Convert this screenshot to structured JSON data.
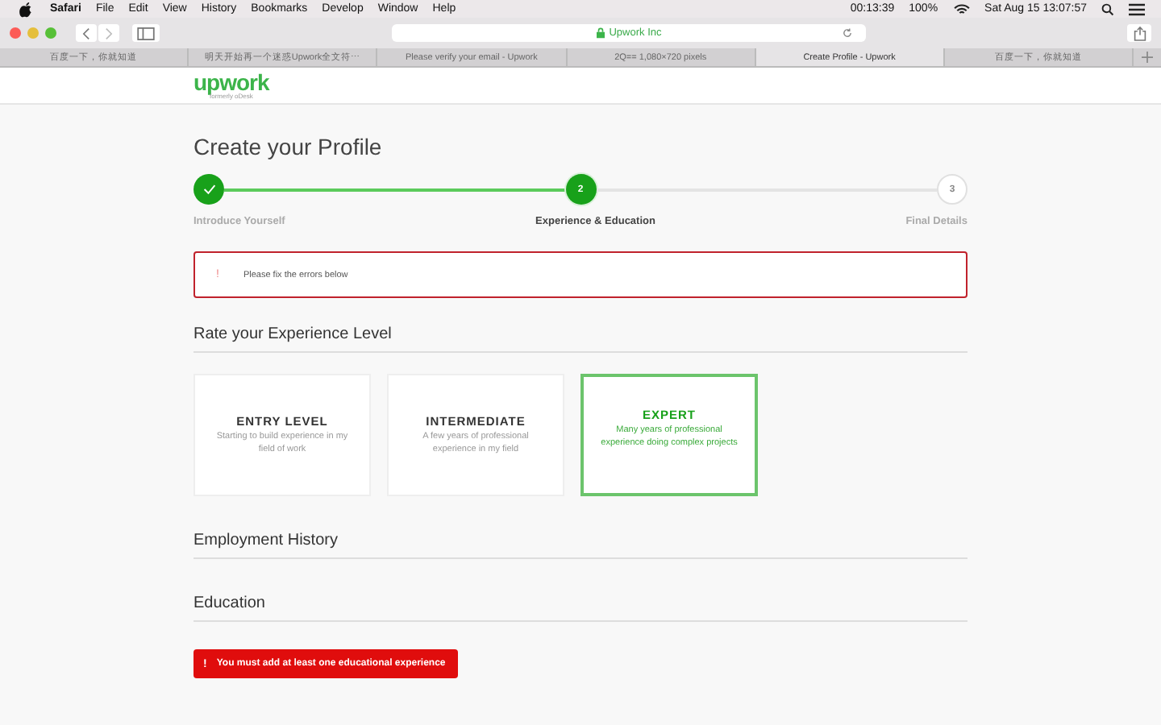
{
  "menu_bar": {
    "app": "Safari",
    "items": [
      "File",
      "Edit",
      "View",
      "History",
      "Bookmarks",
      "Develop",
      "Window",
      "Help"
    ],
    "clock_timer": "00:13:39",
    "battery": "100%",
    "date_time": "Sat Aug 15  13:07:57"
  },
  "toolbar": {
    "address": "Upwork Inc"
  },
  "tabs": [
    {
      "label": "百度一下，你就知道",
      "selected": false
    },
    {
      "label": "明天开始再一个迷惑Upwork全文符⋯",
      "selected": false
    },
    {
      "label": "Please verify your email - Upwork",
      "selected": false
    },
    {
      "label": "2Q== 1,080×720 pixels",
      "selected": false
    },
    {
      "label": "Create Profile - Upwork",
      "selected": true
    },
    {
      "label": "百度一下，你就知道",
      "selected": false
    }
  ],
  "header": {
    "logo": "upwork",
    "tagline": "formerly oDesk"
  },
  "title": "Create your Profile",
  "steps": [
    {
      "label": "Introduce Yourself",
      "completed": true,
      "selected": false
    },
    {
      "label": "Experience & Education",
      "number": "2",
      "completed": false,
      "selected": true
    },
    {
      "label": "Final Details",
      "number": "3",
      "completed": false,
      "selected": false
    }
  ],
  "alert": {
    "icon": "!",
    "message": "Please fix the errors below"
  },
  "experience": {
    "heading": "Rate your Experience Level",
    "levels": [
      {
        "title": "ENTRY LEVEL",
        "description": "Starting to build experience in my field of work",
        "selected": false
      },
      {
        "title": "INTERMEDIATE",
        "description": "A few years of professional experience in my field",
        "selected": false
      },
      {
        "title": "EXPERT",
        "description": "Many years of professional experience doing complex projects",
        "selected": true
      }
    ]
  },
  "sections": [
    "Employment History",
    "Education"
  ],
  "education_error": {
    "icon": "!",
    "message": "You must add at least one educational experience"
  }
}
